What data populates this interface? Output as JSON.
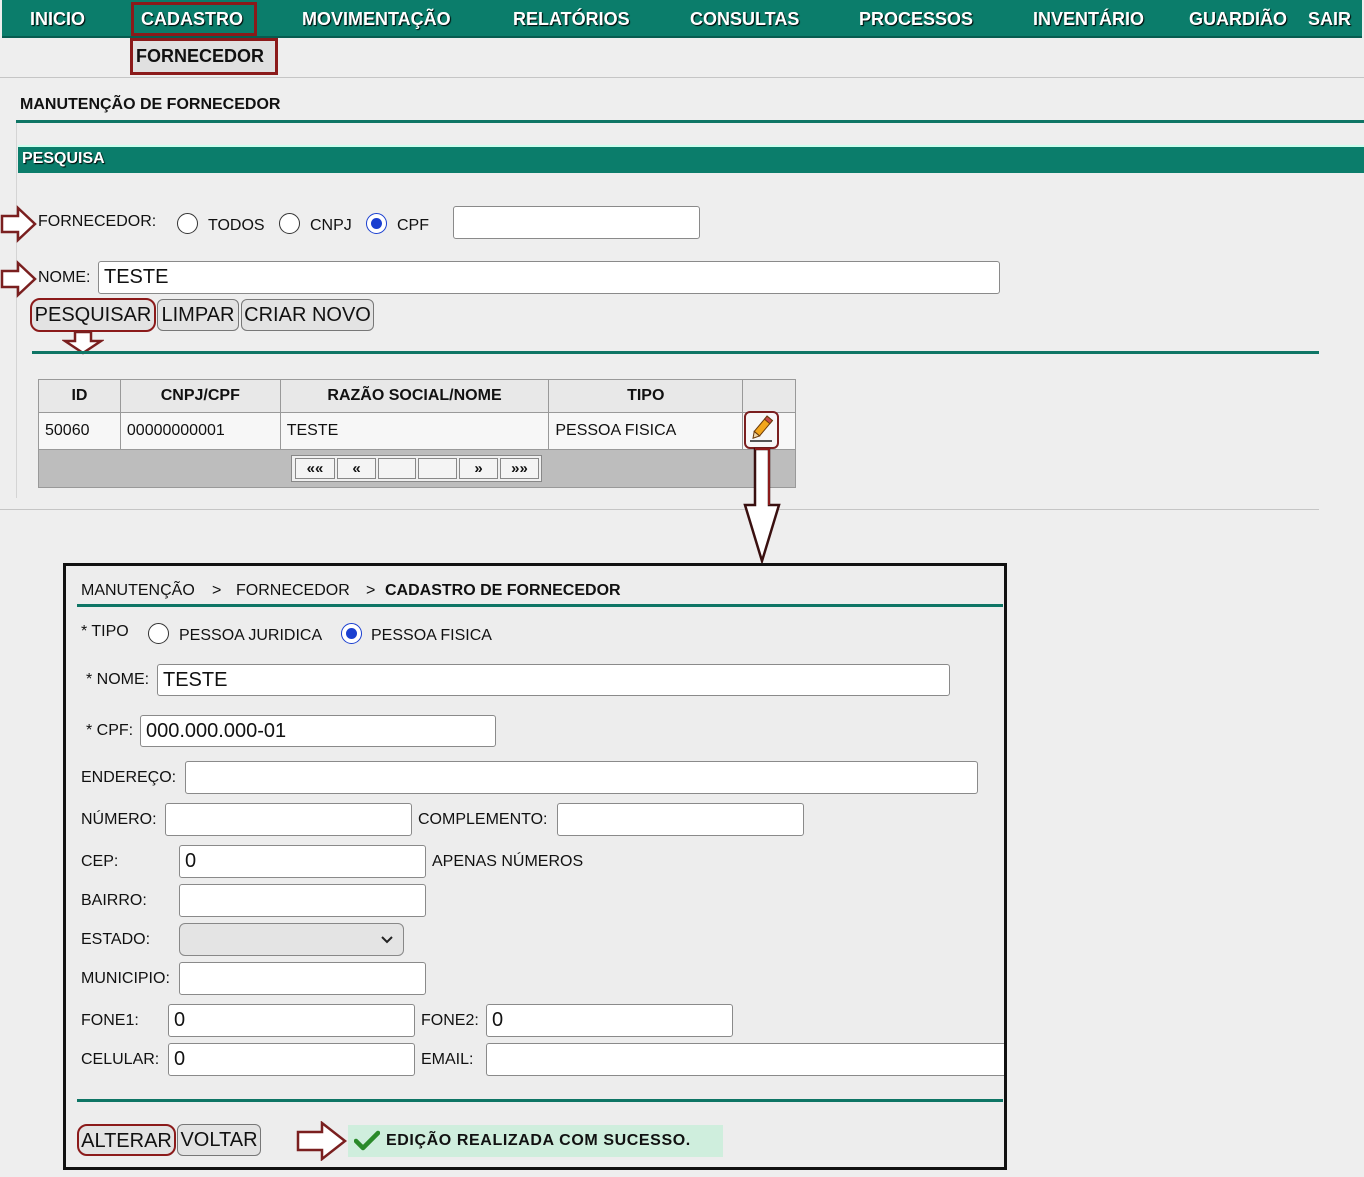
{
  "nav": {
    "items": [
      "INICIO",
      "CADASTRO",
      "MOVIMENTAÇÃO",
      "RELATÓRIOS",
      "CONSULTAS",
      "PROCESSOS",
      "INVENTÁRIO",
      "GUARDIÃO",
      "SAIR"
    ],
    "submenu_item": "FORNECEDOR"
  },
  "page": {
    "title": "MANUTENÇÃO DE FORNECEDOR",
    "section": "PESQUISA"
  },
  "search": {
    "fornecedor_label": "FORNECEDOR:",
    "options": [
      "TODOS",
      "CNPJ",
      "CPF"
    ],
    "selected": "CPF",
    "document_value": "",
    "nome_label": "NOME:",
    "nome_value": "TESTE",
    "buttons": {
      "pesquisar": "PESQUISAR",
      "limpar": "LIMPAR",
      "criar_novo": "CRIAR NOVO"
    }
  },
  "results": {
    "columns": [
      "ID",
      "CNPJ/CPF",
      "RAZÃO SOCIAL/NOME",
      "TIPO",
      ""
    ],
    "rows": [
      {
        "id": "50060",
        "doc": "00000000001",
        "nome": "TESTE",
        "tipo": "PESSOA FISICA"
      }
    ],
    "pager": {
      "first": "««",
      "prev": "«",
      "next": "»",
      "last": "»»"
    }
  },
  "form": {
    "breadcrumb": [
      "MANUTENÇÃO",
      "FORNECEDOR",
      "CADASTRO DE FORNECEDOR"
    ],
    "breadcrumb_sep": ">",
    "tipo_label": "* TIPO",
    "tipo_options": [
      "PESSOA JURIDICA",
      "PESSOA FISICA"
    ],
    "tipo_selected": "PESSOA FISICA",
    "nome_label": "* NOME:",
    "nome_value": "TESTE",
    "cpf_label": "* CPF:",
    "cpf_value": "000.000.000-01",
    "endereco_label": "ENDEREÇO:",
    "endereco_value": "",
    "numero_label": "NÚMERO:",
    "numero_value": "",
    "complemento_label": "COMPLEMENTO:",
    "complemento_value": "",
    "cep_label": "CEP:",
    "cep_value": "0",
    "cep_hint": "APENAS NÚMEROS",
    "bairro_label": "BAIRRO:",
    "bairro_value": "",
    "estado_label": "ESTADO:",
    "estado_value": "",
    "municipio_label": "MUNICIPIO:",
    "municipio_value": "",
    "fone1_label": "FONE1:",
    "fone1_value": "0",
    "fone2_label": "FONE2:",
    "fone2_value": "0",
    "celular_label": "CELULAR:",
    "celular_value": "0",
    "email_label": "EMAIL:",
    "email_value": "",
    "buttons": {
      "alterar": "ALTERAR",
      "voltar": "VOLTAR"
    },
    "success_message": "EDIÇÃO REALIZADA COM SUCESSO."
  },
  "colors": {
    "nav_bg": "#0b7d6b",
    "highlight": "#8b1a1a",
    "success_bg": "#cfeedd",
    "radio_selected": "#1a3fd0"
  }
}
